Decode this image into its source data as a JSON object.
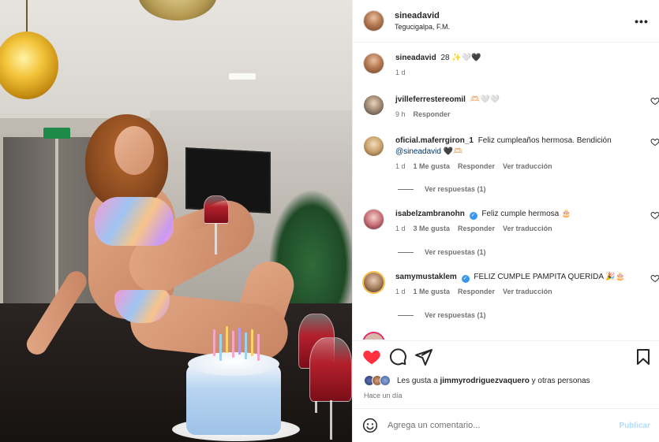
{
  "post": {
    "username": "sineadavid",
    "location": "Tegucigalpa, F.M.",
    "more_label": "•••"
  },
  "caption": {
    "username": "sineadavid",
    "text": "28 ✨🤍🖤",
    "time": "1 d"
  },
  "comments": [
    {
      "username": "jvilleferrestereomil",
      "text": "🫶🏻🤍🤍",
      "verified": false,
      "time": "9 h",
      "likes": "",
      "reply_label": "Responder",
      "translate_label": "",
      "view_replies": ""
    },
    {
      "username": "oficial.maferrgiron_1",
      "text": "Feliz cumpleaños hermosa. Bendición",
      "mention": "@sineadavid",
      "text_after": "🖤🫶🏻",
      "verified": false,
      "time": "1 d",
      "likes": "1 Me gusta",
      "reply_label": "Responder",
      "translate_label": "Ver traducción",
      "view_replies": "Ver respuestas (1)"
    },
    {
      "username": "isabelzambranohn",
      "text": "Feliz cumple hermosa 🎂",
      "verified": true,
      "time": "1 d",
      "likes": "3 Me gusta",
      "reply_label": "Responder",
      "translate_label": "Ver traducción",
      "view_replies": "Ver respuestas (1)"
    },
    {
      "username": "samymustaklem",
      "text": "FELIZ CUMPLE PAMPITA QUERIDA 🎉🎂",
      "verified": true,
      "time": "1 d",
      "likes": "1 Me gusta",
      "reply_label": "Responder",
      "translate_label": "Ver traducción",
      "view_replies": "Ver respuestas (1)"
    }
  ],
  "likes_summary": {
    "prefix": "Les gusta a",
    "user": "jimmyrodriguezvaquero",
    "suffix": "y otras personas"
  },
  "posted_ago": "Hace un día",
  "composer": {
    "placeholder": "Agrega un comentario...",
    "post_label": "Publicar"
  },
  "icons": {
    "like": "heart-filled-icon",
    "comment": "comment-icon",
    "share": "share-icon",
    "save": "bookmark-icon",
    "emoji": "emoji-icon"
  },
  "colors": {
    "like_red": "#ff3040",
    "link_blue": "#00376b",
    "verified_blue": "#3897f0",
    "muted": "#737373",
    "post_button": "#b3dbff"
  }
}
